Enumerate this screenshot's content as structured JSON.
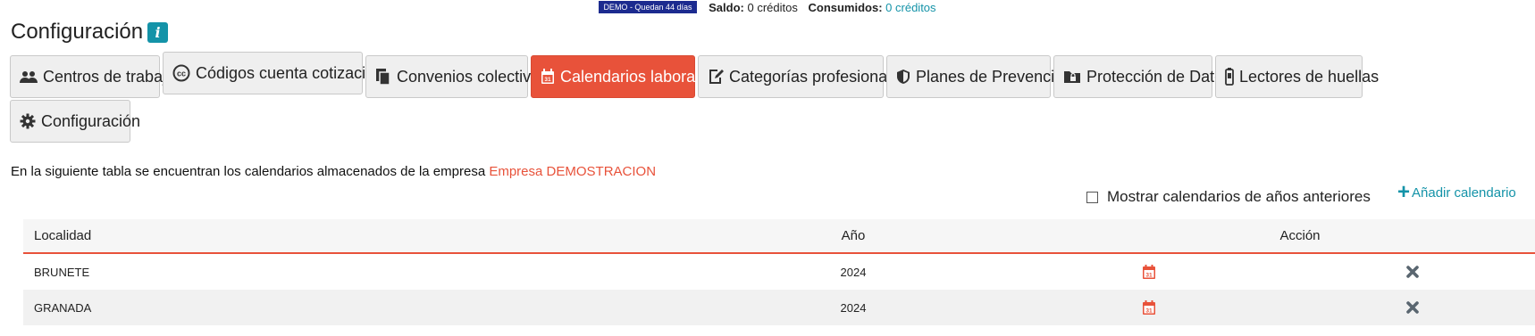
{
  "topbar": {
    "demo_badge": "DEMO  - Quedan 44 días",
    "balance_label": "Saldo:",
    "balance_value": "0 créditos",
    "consumed_label": "Consumidos:",
    "consumed_value": "0 créditos"
  },
  "page": {
    "title": "Configuración",
    "info_icon": "info-icon"
  },
  "tabs": [
    {
      "label": "Centros de trabajo",
      "icon": "users-icon"
    },
    {
      "label": "Códigos cuenta cotización",
      "icon": "cc-icon"
    },
    {
      "label": "Convenios colectivos",
      "icon": "documents-icon"
    },
    {
      "label": "Calendarios laborales",
      "icon": "calendar-icon",
      "active": true
    },
    {
      "label": "Categorías profesionales",
      "icon": "edit-document-icon"
    },
    {
      "label": "Planes de Prevención",
      "icon": "shield-icon"
    },
    {
      "label": "Protección de Datos",
      "icon": "folder-lock-icon"
    },
    {
      "label": "Lectores de huellas",
      "icon": "fingerprint-reader-icon"
    },
    {
      "label": "Configuración",
      "icon": "gear-icon"
    }
  ],
  "description": {
    "text": "En la siguiente tabla se encuentran los calendarios almacenados de la empresa ",
    "company": "Empresa DEMOSTRACION"
  },
  "controls": {
    "show_previous_label": "Mostrar calendarios de años anteriores",
    "show_previous_checked": false,
    "add_calendar_label": "Añadir calendario"
  },
  "table": {
    "headers": {
      "locality": "Localidad",
      "year": "Año",
      "action": "Acción"
    },
    "rows": [
      {
        "locality": "BRUNETE",
        "year": "2024"
      },
      {
        "locality": "GRANADA",
        "year": "2024"
      }
    ]
  },
  "colors": {
    "accent": "#e8523a",
    "link": "#1493a8",
    "demo_badge": "#1c2b8f",
    "delete_icon": "#5a6670"
  }
}
